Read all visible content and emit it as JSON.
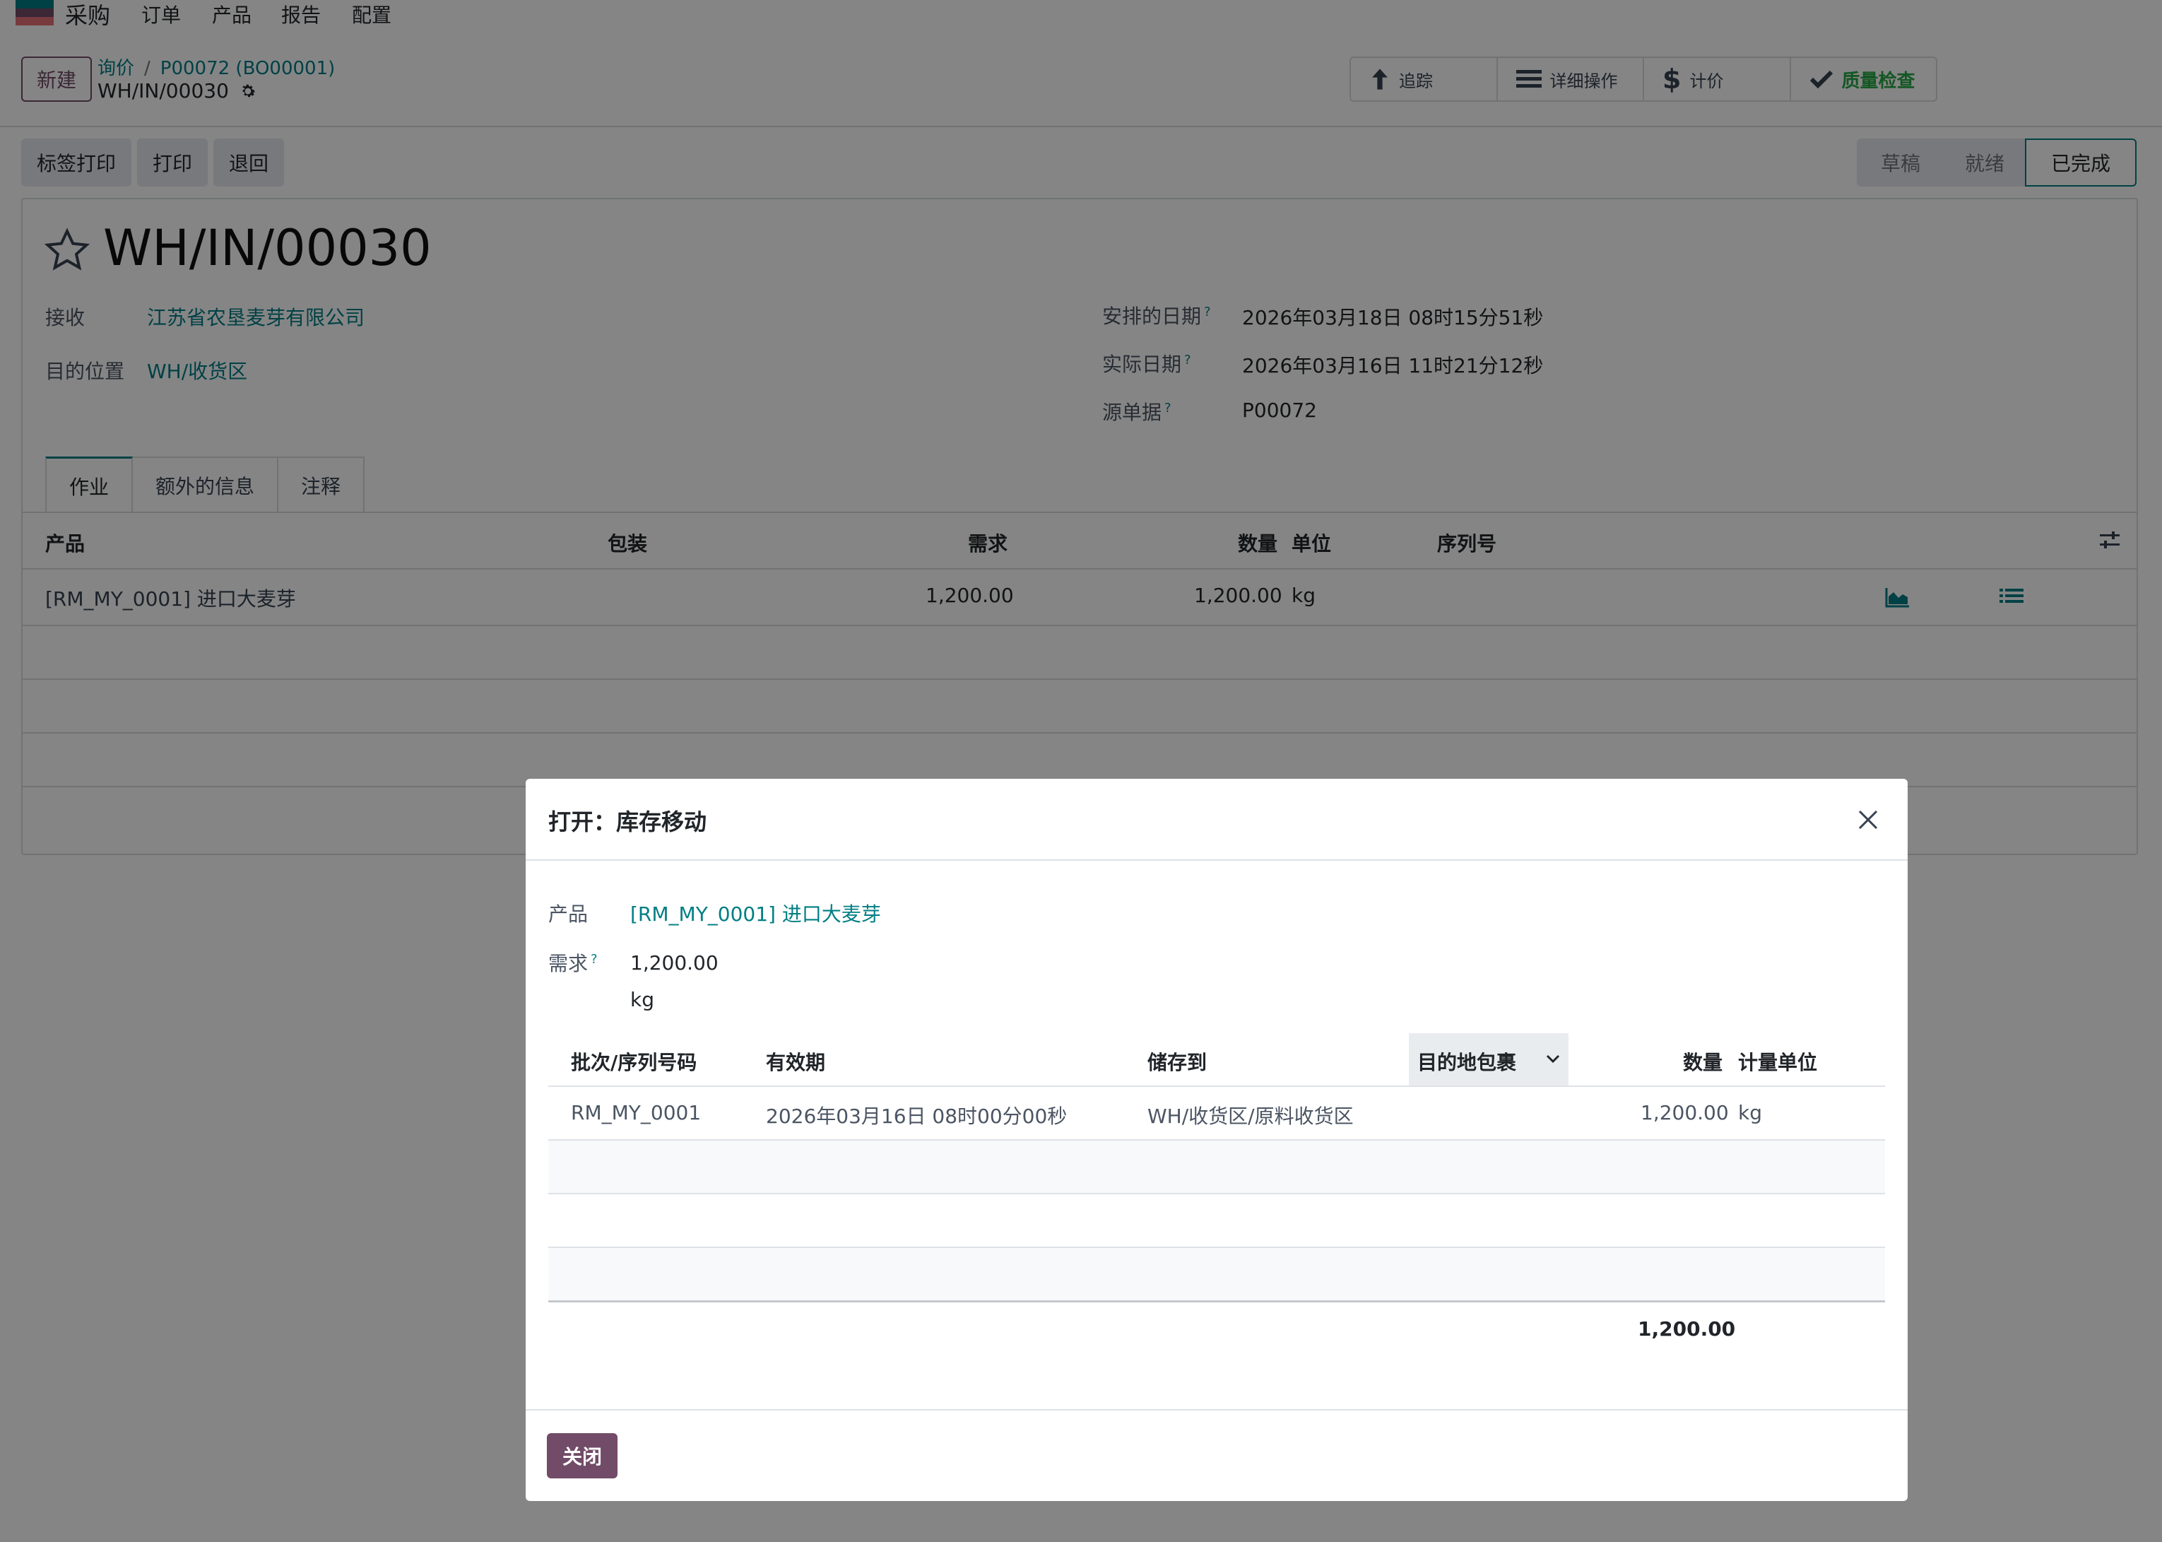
{
  "app": {
    "name": "采购",
    "brand_color": "#714b67",
    "link_color": "#017e84"
  },
  "menu": [
    "订单",
    "产品",
    "报告",
    "配置"
  ],
  "control_panel": {
    "new_button": "新建",
    "breadcrumb": {
      "parent": "询价",
      "current": "P00072 (BO00001)"
    },
    "record": "WH/IN/00030",
    "smart_buttons": [
      "追踪",
      "详细操作",
      "计价",
      "质量检查"
    ]
  },
  "actions": [
    "标签打印",
    "打印",
    "退回"
  ],
  "statusbar": {
    "stages": [
      "草稿",
      "就绪",
      "已完成"
    ],
    "current": "已完成"
  },
  "form": {
    "title": "WH/IN/00030",
    "left_fields": [
      {
        "label": "接收",
        "value": "江苏省农垦麦芽有限公司"
      },
      {
        "label": "目的位置",
        "value": "WH/收货区"
      }
    ],
    "right_fields": [
      {
        "label": "安排的日期",
        "help": "?",
        "value": "2026年03月18日 08时15分51秒"
      },
      {
        "label": "实际日期",
        "help": "?",
        "value": "2026年03月16日 11时21分12秒"
      },
      {
        "label": "源单据",
        "help": "?",
        "value": "P00072"
      }
    ],
    "tabs": [
      "作业",
      "额外的信息",
      "注释"
    ],
    "table": {
      "headers": [
        "产品",
        "包装",
        "需求",
        "数量",
        "单位",
        "序列号"
      ],
      "rows": [
        {
          "product": "[RM_MY_0001] 进口大麦芽",
          "demand": "1,200.00",
          "quantity": "1,200.00",
          "uom": "kg"
        }
      ]
    }
  },
  "dialog": {
    "title": "打开：库存移动",
    "product_label": "产品",
    "product_value": "[RM_MY_0001] 进口大麦芽",
    "demand_label": "需求",
    "demand_help": "?",
    "demand_value": "1,200.00",
    "demand_uom": "kg",
    "headers": [
      "批次/序列号码",
      "有效期",
      "储存到",
      "目的地包裹",
      "数量",
      "计量单位"
    ],
    "rows": [
      {
        "lot": "RM_MY_0001",
        "expiry": "2026年03月16日 08时00分00秒",
        "location": "WH/收货区/原料收货区",
        "package": "",
        "qty": "1,200.00",
        "uom": "kg"
      }
    ],
    "total": "1,200.00",
    "close_button": "关闭"
  }
}
